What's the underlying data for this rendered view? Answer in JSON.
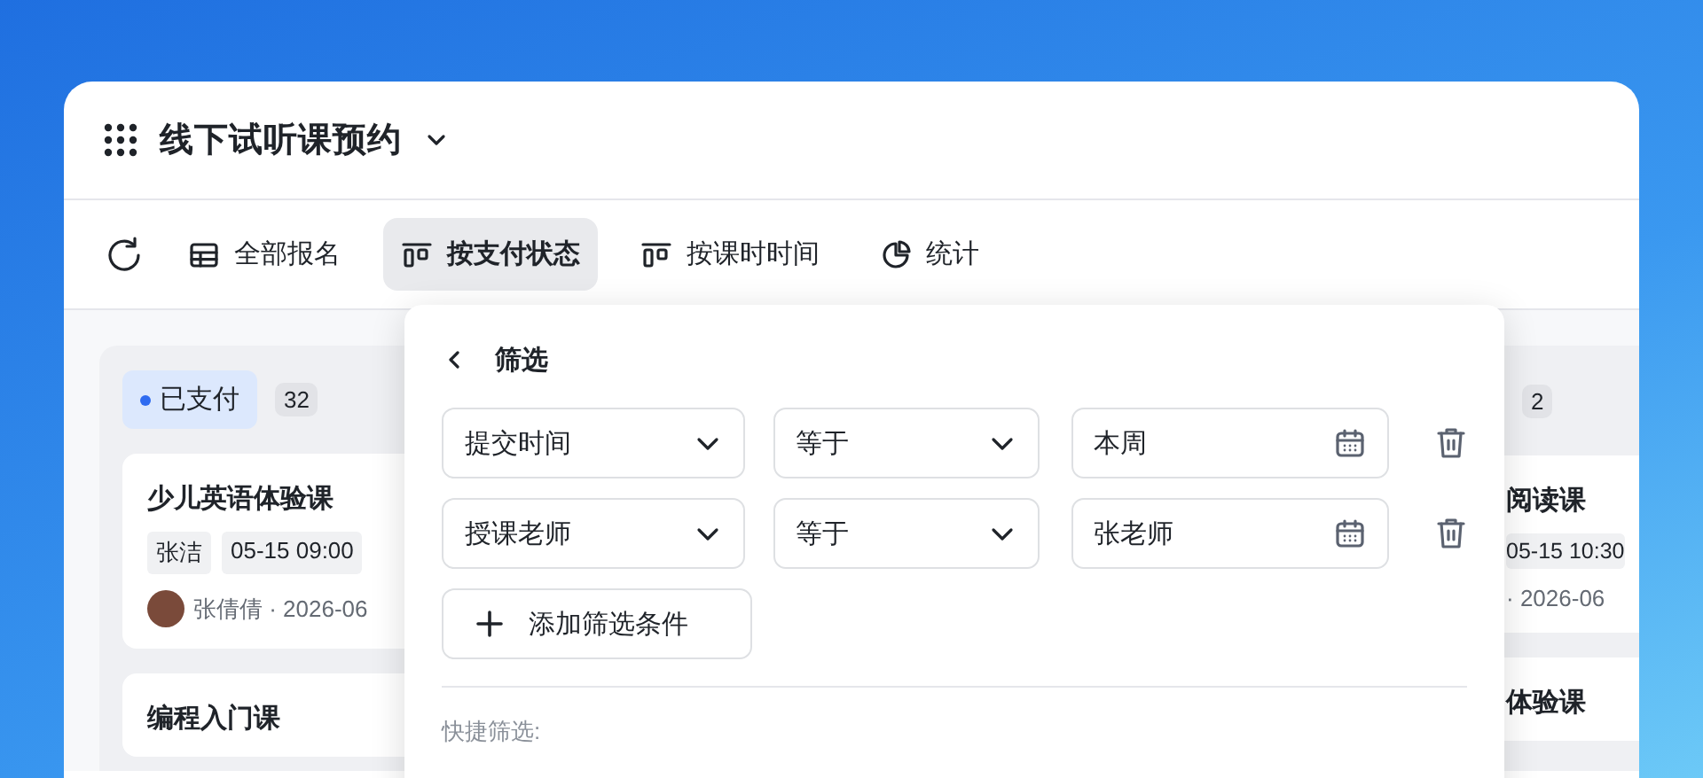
{
  "app": {
    "title": "线下试听课预约"
  },
  "toolbar": [
    {
      "kind": "table",
      "label": "全部报名",
      "selected": false
    },
    {
      "kind": "kanban",
      "label": "按支付状态",
      "selected": true
    },
    {
      "kind": "kanban",
      "label": "按课时时间",
      "selected": false
    },
    {
      "kind": "chart",
      "label": "统计",
      "selected": false
    }
  ],
  "columns": [
    {
      "status": "已支付",
      "color": "#2f6bf0",
      "count": "32",
      "cards": [
        {
          "title": "少儿英语体验课",
          "tags": [
            "张洁",
            "05-15 09:00"
          ],
          "avatar": true,
          "meta": "张倩倩 · 2026-06"
        },
        {
          "title": "编程入门课"
        }
      ]
    },
    {
      "count": "2",
      "cards": [
        {
          "title": "阅读课",
          "tags": [
            "05-15 10:30"
          ],
          "avatar": false,
          "meta": "· 2026-06"
        },
        {
          "title": "体验课"
        }
      ]
    }
  ],
  "filter_panel": {
    "title": "筛选",
    "conditions": [
      {
        "field": "提交时间",
        "operator": "等于",
        "value": "本周"
      },
      {
        "field": "授课老师",
        "operator": "等于",
        "value": "张老师"
      }
    ],
    "add_label": "添加筛选条件",
    "quick_label": "快捷筛选:"
  }
}
